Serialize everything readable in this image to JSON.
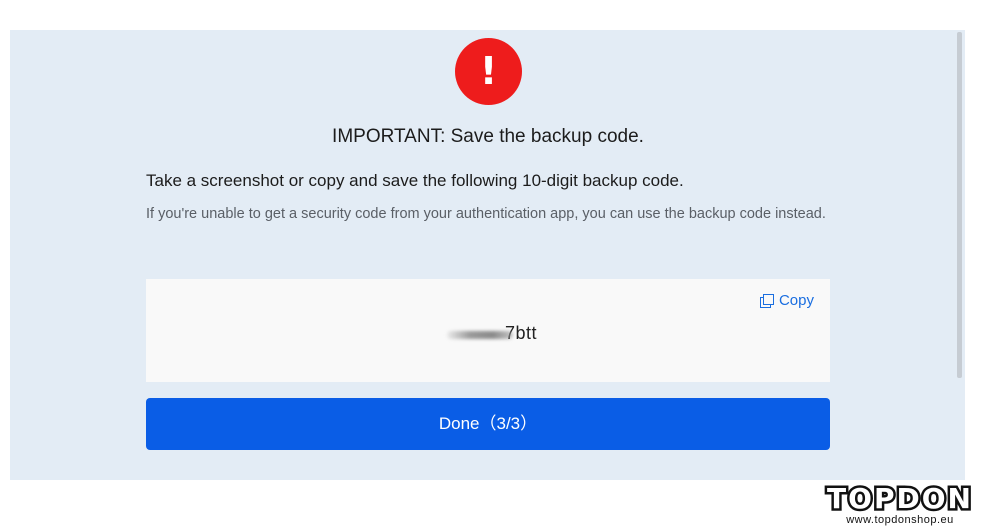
{
  "dialog": {
    "alert_symbol": "!",
    "title": "IMPORTANT: Save the backup code.",
    "instruction": "Take a screenshot or copy and save the following 10-digit backup code.",
    "info": "If you're unable to get a security code from your authentication app, you can use the backup code instead.",
    "code_visible_suffix": "7btt",
    "copy_label": "Copy",
    "done_label": "Done（3/3）"
  },
  "icons": {
    "alert": "exclamation-circle-icon",
    "copy": "copy-icon"
  },
  "colors": {
    "panel_background": "#e3ecf5",
    "alert_red": "#ee1c1c",
    "primary_blue": "#0a5de6",
    "link_blue": "#1a6ee0"
  },
  "watermark": {
    "brand": "TOPDON",
    "url": "www.topdonshop.eu"
  }
}
